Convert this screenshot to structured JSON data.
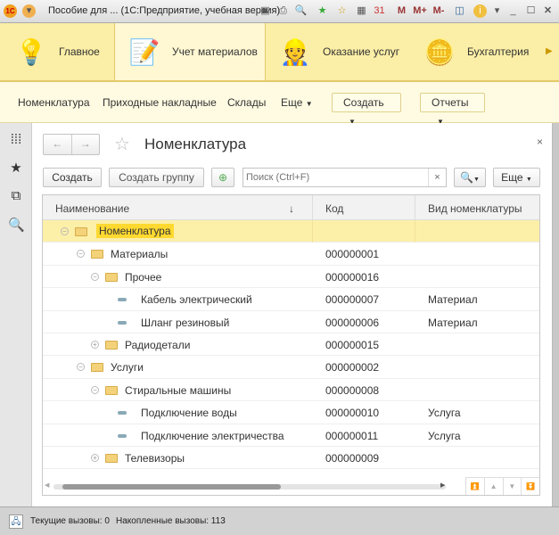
{
  "window": {
    "title": "Пособие для ... (1С:Предприятие, учебная версия)",
    "toolbar": [
      "M",
      "M+",
      "M-"
    ]
  },
  "sections": [
    {
      "label": "Главное",
      "icon": "desk-lamp-icon"
    },
    {
      "label": "Учет материалов",
      "icon": "notepad-pencil-icon"
    },
    {
      "label": "Оказание услуг",
      "icon": "worker-icon"
    },
    {
      "label": "Бухгалтерия",
      "icon": "coins-icon"
    }
  ],
  "nav": {
    "items": [
      "Номенклатура",
      "Приходные накладные",
      "Склады"
    ],
    "more": "Еще",
    "create": "Создать",
    "reports": "Отчеты"
  },
  "form": {
    "title": "Номенклатура",
    "create": "Создать",
    "create_group": "Создать группу",
    "search_placeholder": "Поиск (Ctrl+F)",
    "clear": "×",
    "more": "Еще",
    "close": "×"
  },
  "table": {
    "columns": [
      "Наименование",
      "Код",
      "Вид номенклатуры"
    ],
    "sort": "↓",
    "rows": [
      {
        "name": "Номенклатура",
        "code": "",
        "kind": "",
        "level": 0,
        "type": "group",
        "state": "open"
      },
      {
        "name": "Материалы",
        "code": "000000001",
        "kind": "",
        "level": 1,
        "type": "group",
        "state": "open"
      },
      {
        "name": "Прочее",
        "code": "000000016",
        "kind": "",
        "level": 2,
        "type": "group",
        "state": "open"
      },
      {
        "name": "Кабель электрический",
        "code": "000000007",
        "kind": "Материал",
        "level": 3,
        "type": "item"
      },
      {
        "name": "Шланг резиновый",
        "code": "000000006",
        "kind": "Материал",
        "level": 3,
        "type": "item"
      },
      {
        "name": "Радиодетали",
        "code": "000000015",
        "kind": "",
        "level": 2,
        "type": "group",
        "state": "closed"
      },
      {
        "name": "Услуги",
        "code": "000000002",
        "kind": "",
        "level": 1,
        "type": "group",
        "state": "open"
      },
      {
        "name": "Стиральные машины",
        "code": "000000008",
        "kind": "",
        "level": 2,
        "type": "group",
        "state": "open"
      },
      {
        "name": "Подключение воды",
        "code": "000000010",
        "kind": "Услуга",
        "level": 3,
        "type": "item"
      },
      {
        "name": "Подключение электричества",
        "code": "000000011",
        "kind": "Услуга",
        "level": 3,
        "type": "item"
      },
      {
        "name": "Телевизоры",
        "code": "000000009",
        "kind": "",
        "level": 2,
        "type": "group",
        "state": "closed"
      }
    ]
  },
  "status": {
    "current": "Текущие вызовы: 0",
    "accumulated": "Накопленные вызовы: 113"
  }
}
